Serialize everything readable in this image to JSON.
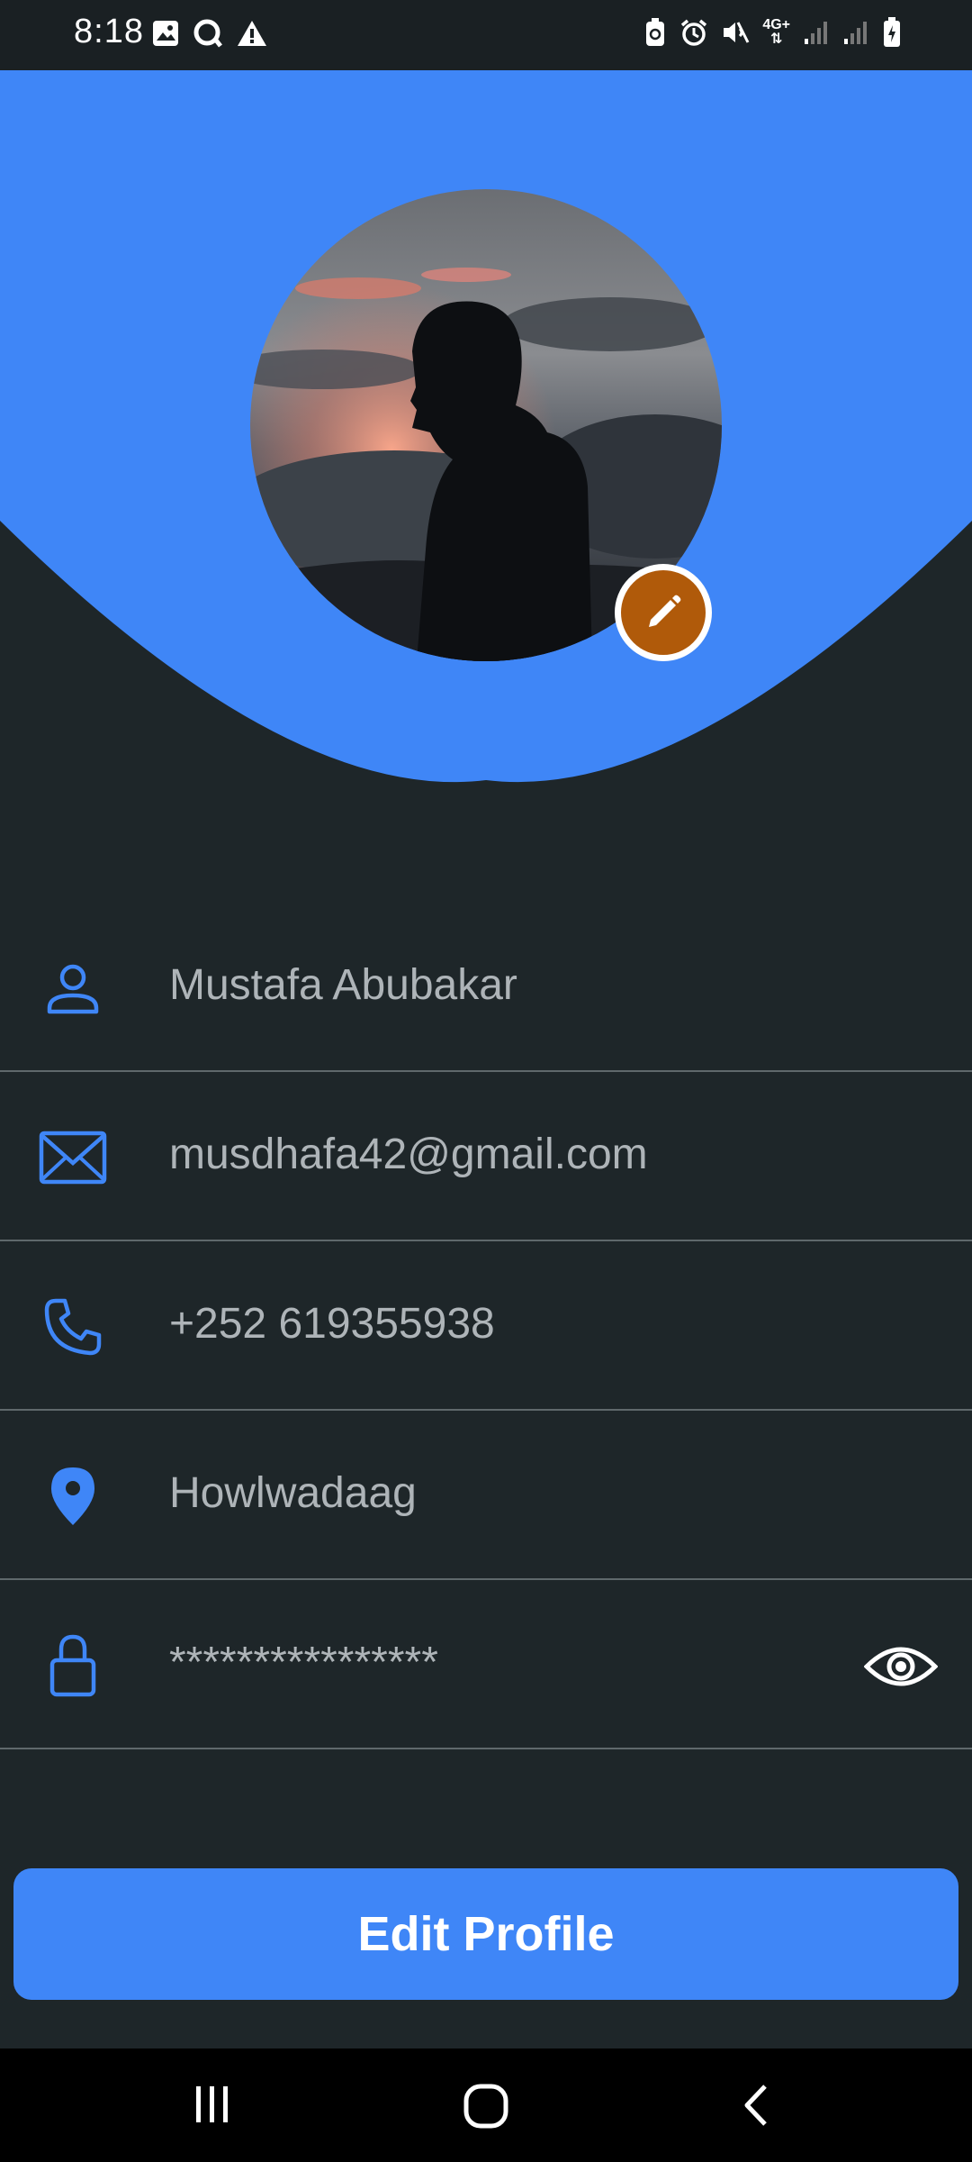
{
  "status_bar": {
    "time": "8:18",
    "network_label": "4G+",
    "icons": [
      "gallery-icon",
      "message-icon",
      "warning-icon",
      "battery-saver-icon",
      "alarm-icon",
      "mute-icon",
      "network-icon",
      "signal-icon",
      "signal-icon",
      "battery-icon"
    ]
  },
  "colors": {
    "accent": "#3f86f7",
    "background": "#1e2629",
    "edit_badge": "#b05a0a",
    "text_muted": "#aeb4b8"
  },
  "profile": {
    "avatar_icon": "user-photo",
    "fields": [
      {
        "icon": "person-icon",
        "value": "Mustafa Abubakar"
      },
      {
        "icon": "mail-icon",
        "value": "musdhafa42@gmail.com"
      },
      {
        "icon": "phone-icon",
        "value": "+252 619355938"
      },
      {
        "icon": "location-icon",
        "value": "Howlwadaag"
      },
      {
        "icon": "lock-icon",
        "value": "****************"
      }
    ]
  },
  "actions": {
    "edit_profile_label": "Edit Profile"
  },
  "navigation": {
    "buttons": [
      "recents-icon",
      "home-icon",
      "back-icon"
    ]
  }
}
